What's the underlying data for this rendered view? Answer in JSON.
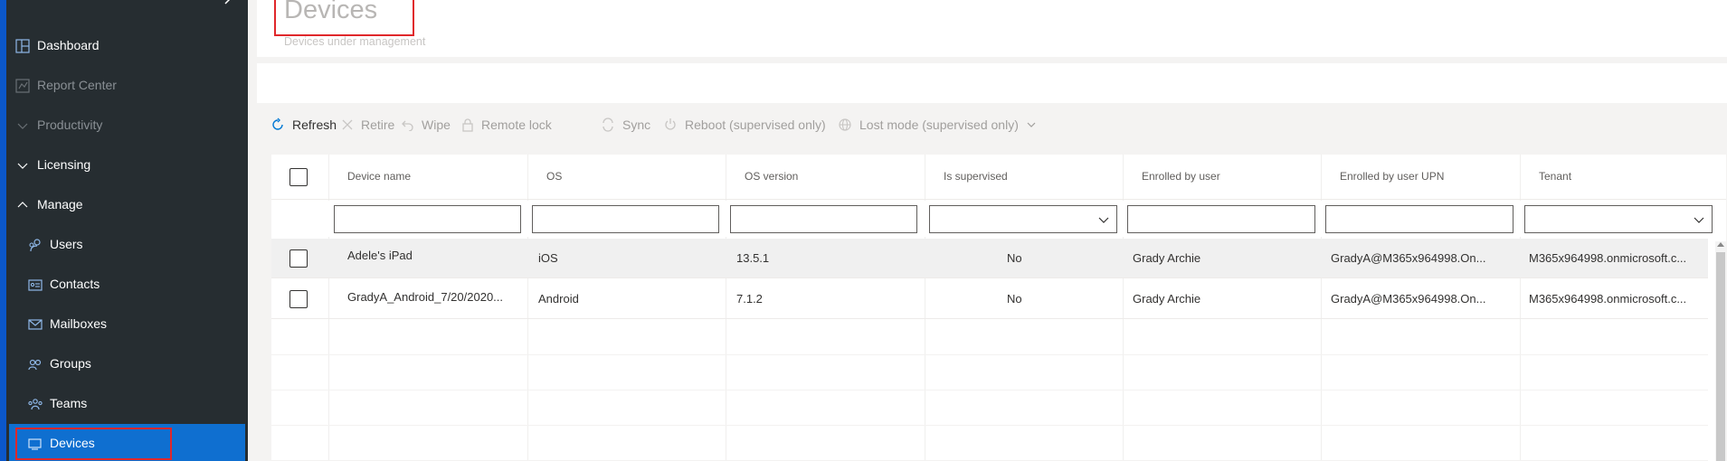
{
  "sidebar": {
    "items": [
      {
        "label": "Dashboard",
        "icon": "dashboard-icon"
      },
      {
        "label": "Report Center",
        "icon": "report-icon"
      },
      {
        "label": "Productivity",
        "icon": "chevron-down-icon"
      },
      {
        "label": "Licensing",
        "icon": "chevron-down-icon"
      },
      {
        "label": "Manage",
        "icon": "chevron-up-icon"
      },
      {
        "label": "Users",
        "icon": "users-icon"
      },
      {
        "label": "Contacts",
        "icon": "contacts-icon"
      },
      {
        "label": "Mailboxes",
        "icon": "mail-icon"
      },
      {
        "label": "Groups",
        "icon": "groups-icon"
      },
      {
        "label": "Teams",
        "icon": "teams-icon"
      },
      {
        "label": "Devices",
        "icon": "devices-icon"
      }
    ]
  },
  "page": {
    "title": "Devices",
    "subtitle": "Devices under management"
  },
  "toolbar": {
    "refresh": "Refresh",
    "retire": "Retire",
    "wipe": "Wipe",
    "remote_lock": "Remote lock",
    "sync": "Sync",
    "reboot": "Reboot (supervised only)",
    "lost_mode": "Lost mode (supervised only)"
  },
  "grid": {
    "columns": [
      "Device name",
      "OS",
      "OS version",
      "Is supervised",
      "Enrolled by user",
      "Enrolled by user UPN",
      "Tenant"
    ],
    "rows": [
      [
        "Adele's iPad",
        "iOS",
        "13.5.1",
        "No",
        "Grady Archie",
        "GradyA@M365x964998.On...",
        "M365x964998.onmicrosoft.c..."
      ],
      [
        "GradyA_Android_7/20/2020...",
        "Android",
        "7.1.2",
        "No",
        "Grady Archie",
        "GradyA@M365x964998.On...",
        "M365x964998.onmicrosoft.c..."
      ]
    ]
  },
  "colors": {
    "sidebar_bg": "#262d31",
    "active_bg": "#0f6fd0",
    "highlight_outline": "#e0272b",
    "accent": "#0078d4"
  }
}
